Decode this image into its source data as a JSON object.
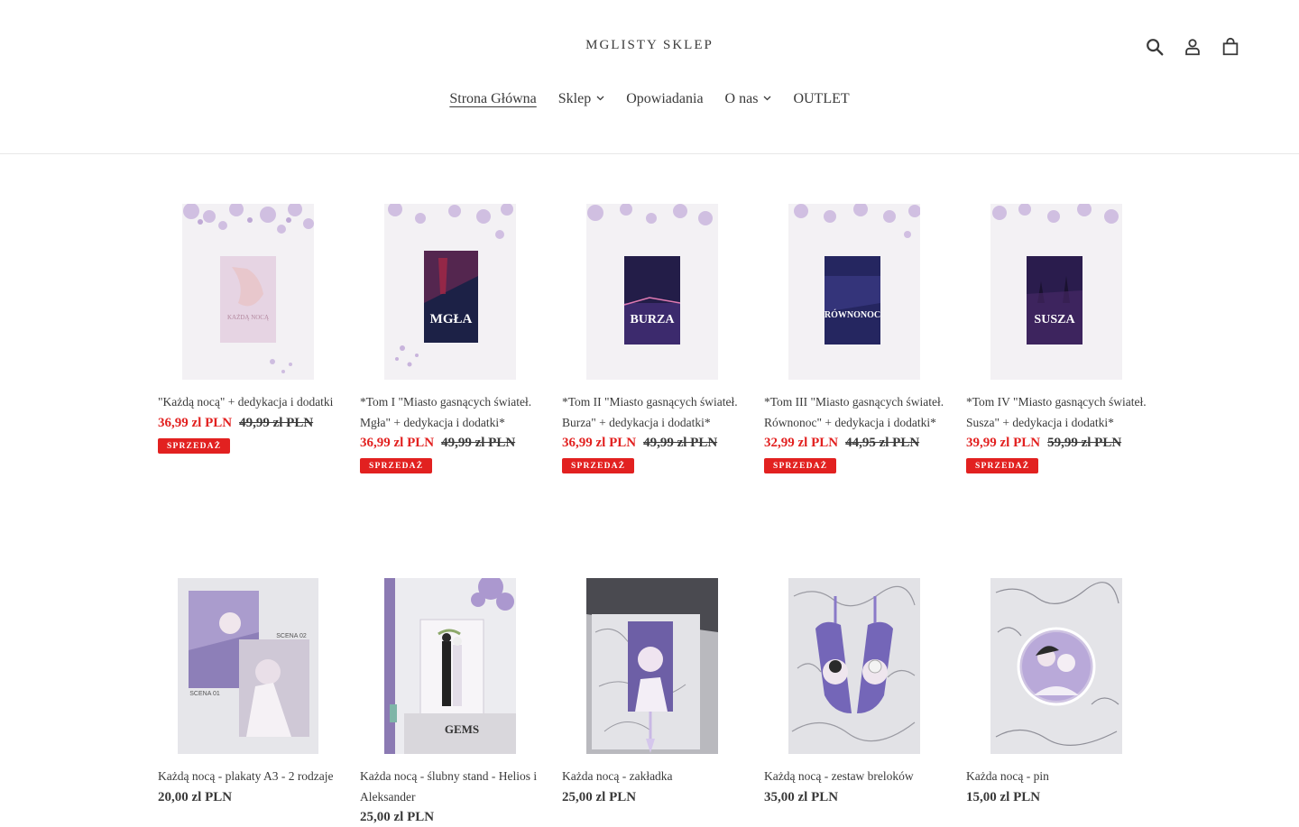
{
  "header": {
    "logo": "MGLISTY SKLEP",
    "icons": [
      "search-icon",
      "account-icon",
      "cart-icon"
    ]
  },
  "nav": {
    "items": [
      {
        "label": "Strona Główna",
        "has_dropdown": false,
        "active": true
      },
      {
        "label": "Sklep",
        "has_dropdown": true,
        "active": false
      },
      {
        "label": "Opowiadania",
        "has_dropdown": false,
        "active": false
      },
      {
        "label": "O nas",
        "has_dropdown": true,
        "active": false
      },
      {
        "label": "OUTLET",
        "has_dropdown": false,
        "active": false
      }
    ]
  },
  "products_row1": [
    {
      "title": "\"Każdą nocą\" + dedykacja i dodatki",
      "sale_price": "36,99 zl PLN",
      "old_price": "49,99 zl PLN",
      "badge": "SPRZEDAŻ",
      "cover_text": ""
    },
    {
      "title": "*Tom I \"Miasto gasnących świateł. Mgła\" + dedykacja i dodatki*",
      "sale_price": "36,99 zl PLN",
      "old_price": "49,99 zl PLN",
      "badge": "SPRZEDAŻ",
      "cover_text": "MGŁA"
    },
    {
      "title": "*Tom II \"Miasto gasnących świateł. Burza\" + dedykacja i dodatki*",
      "sale_price": "36,99 zl PLN",
      "old_price": "49,99 zl PLN",
      "badge": "SPRZEDAŻ",
      "cover_text": "BURZA"
    },
    {
      "title": "*Tom III \"Miasto gasnących świateł. Równonoc\" + dedykacja i dodatki*",
      "sale_price": "32,99 zl PLN",
      "old_price": "44,95 zl PLN",
      "badge": "SPRZEDAŻ",
      "cover_text": "RÓWNONOC"
    },
    {
      "title": "*Tom IV \"Miasto gasnących świateł. Susza\" + dedykacja i dodatki*",
      "sale_price": "39,99 zl PLN",
      "old_price": "59,99 zl PLN",
      "badge": "SPRZEDAŻ",
      "cover_text": "SUSZA"
    }
  ],
  "products_row2": [
    {
      "title": "Każdą nocą - plakaty A3 - 2 rodzaje",
      "price": "20,00 zl PLN",
      "labels": [
        "SCENA 02",
        "SCENA 01"
      ]
    },
    {
      "title": "Każda nocą - ślubny stand - Helios i Aleksander",
      "price": "25,00 zl PLN",
      "labels": [
        "GEMS"
      ]
    },
    {
      "title": "Każda nocą - zakładka",
      "price": "25,00 zl PLN",
      "labels": []
    },
    {
      "title": "Każdą nocą - zestaw breloków",
      "price": "35,00 zl PLN",
      "labels": []
    },
    {
      "title": "Każda nocą - pin",
      "price": "15,00 zl PLN",
      "labels": []
    }
  ],
  "colors": {
    "sale": "#e22120",
    "text": "#3a3a3a",
    "border": "#e8e8e8"
  }
}
